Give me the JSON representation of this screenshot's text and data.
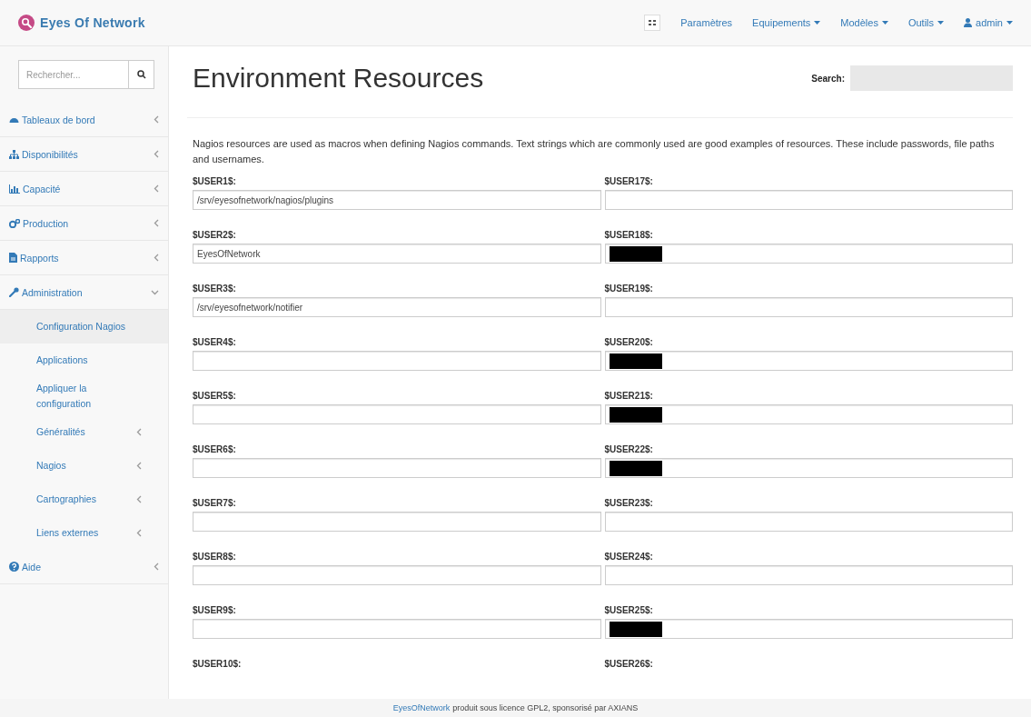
{
  "brand": {
    "name": "Eyes Of Network"
  },
  "navbar": {
    "items": [
      {
        "kind": "grid"
      },
      {
        "kind": "link",
        "label": "Paramètres"
      },
      {
        "kind": "dropdown",
        "label": "Equipements"
      },
      {
        "kind": "dropdown",
        "label": "Modèles"
      },
      {
        "kind": "dropdown",
        "label": "Outils"
      },
      {
        "kind": "user",
        "label": "admin"
      }
    ]
  },
  "sidebar": {
    "search": {
      "placeholder": "Rechercher..."
    },
    "items": [
      {
        "label": "Tableaux de bord",
        "expanded": false
      },
      {
        "label": "Disponibilités",
        "expanded": false
      },
      {
        "label": "Capacité",
        "expanded": false
      },
      {
        "label": "Production",
        "expanded": false
      },
      {
        "label": "Rapports",
        "expanded": false
      },
      {
        "label": "Administration",
        "expanded": true,
        "children": [
          {
            "label": "Configuration Nagios",
            "selected": true,
            "has_submenu": false
          },
          {
            "label": "Applications",
            "selected": false,
            "has_submenu": false
          },
          {
            "label": "Appliquer la configuration",
            "selected": false,
            "has_submenu": false
          },
          {
            "label": "Généralités",
            "selected": false,
            "has_submenu": true
          },
          {
            "label": "Nagios",
            "selected": false,
            "has_submenu": true
          },
          {
            "label": "Cartographies",
            "selected": false,
            "has_submenu": true
          },
          {
            "label": "Liens externes",
            "selected": false,
            "has_submenu": true
          }
        ]
      },
      {
        "label": "Aide",
        "expanded": false
      }
    ]
  },
  "page": {
    "title": "Environment Resources",
    "search_label": "Search:",
    "description": "Nagios resources are used as macros when defining Nagios commands. Text strings which are commonly used are good examples of resources. These include passwords, file paths and usernames.",
    "resources": [
      {
        "left": {
          "label": "$USER1$:",
          "value": "/srv/eyesofnetwork/nagios/plugins",
          "redacted": false
        },
        "right": {
          "label": "$USER17$:",
          "redacted": false
        }
      },
      {
        "left": {
          "label": "$USER2$:",
          "value": "EyesOfNetwork",
          "redacted": false
        },
        "right": {
          "label": "$USER18$:",
          "redacted": true
        }
      },
      {
        "left": {
          "label": "$USER3$:",
          "value": "/srv/eyesofnetwork/notifier",
          "redacted": false
        },
        "right": {
          "label": "$USER19$:",
          "redacted": false
        }
      },
      {
        "left": {
          "label": "$USER4$:",
          "redacted": false
        },
        "right": {
          "label": "$USER20$:",
          "redacted": true
        }
      },
      {
        "left": {
          "label": "$USER5$:",
          "redacted": false
        },
        "right": {
          "label": "$USER21$:",
          "redacted": true
        }
      },
      {
        "left": {
          "label": "$USER6$:",
          "redacted": false
        },
        "right": {
          "label": "$USER22$:",
          "redacted": true
        }
      },
      {
        "left": {
          "label": "$USER7$:",
          "redacted": false
        },
        "right": {
          "label": "$USER23$:",
          "redacted": false
        }
      },
      {
        "left": {
          "label": "$USER8$:",
          "redacted": false
        },
        "right": {
          "label": "$USER24$:",
          "redacted": false
        }
      },
      {
        "left": {
          "label": "$USER9$:",
          "redacted": false
        },
        "right": {
          "label": "$USER25$:",
          "redacted": true
        }
      },
      {
        "left": {
          "label": "$USER10$:",
          "field_visible": false
        },
        "right": {
          "label": "$USER26$:",
          "field_visible": false
        }
      }
    ]
  },
  "footer": {
    "link": "EyesOfNetwork",
    "text": "produit sous licence GPL2, sponsorisé par AXIANS"
  }
}
